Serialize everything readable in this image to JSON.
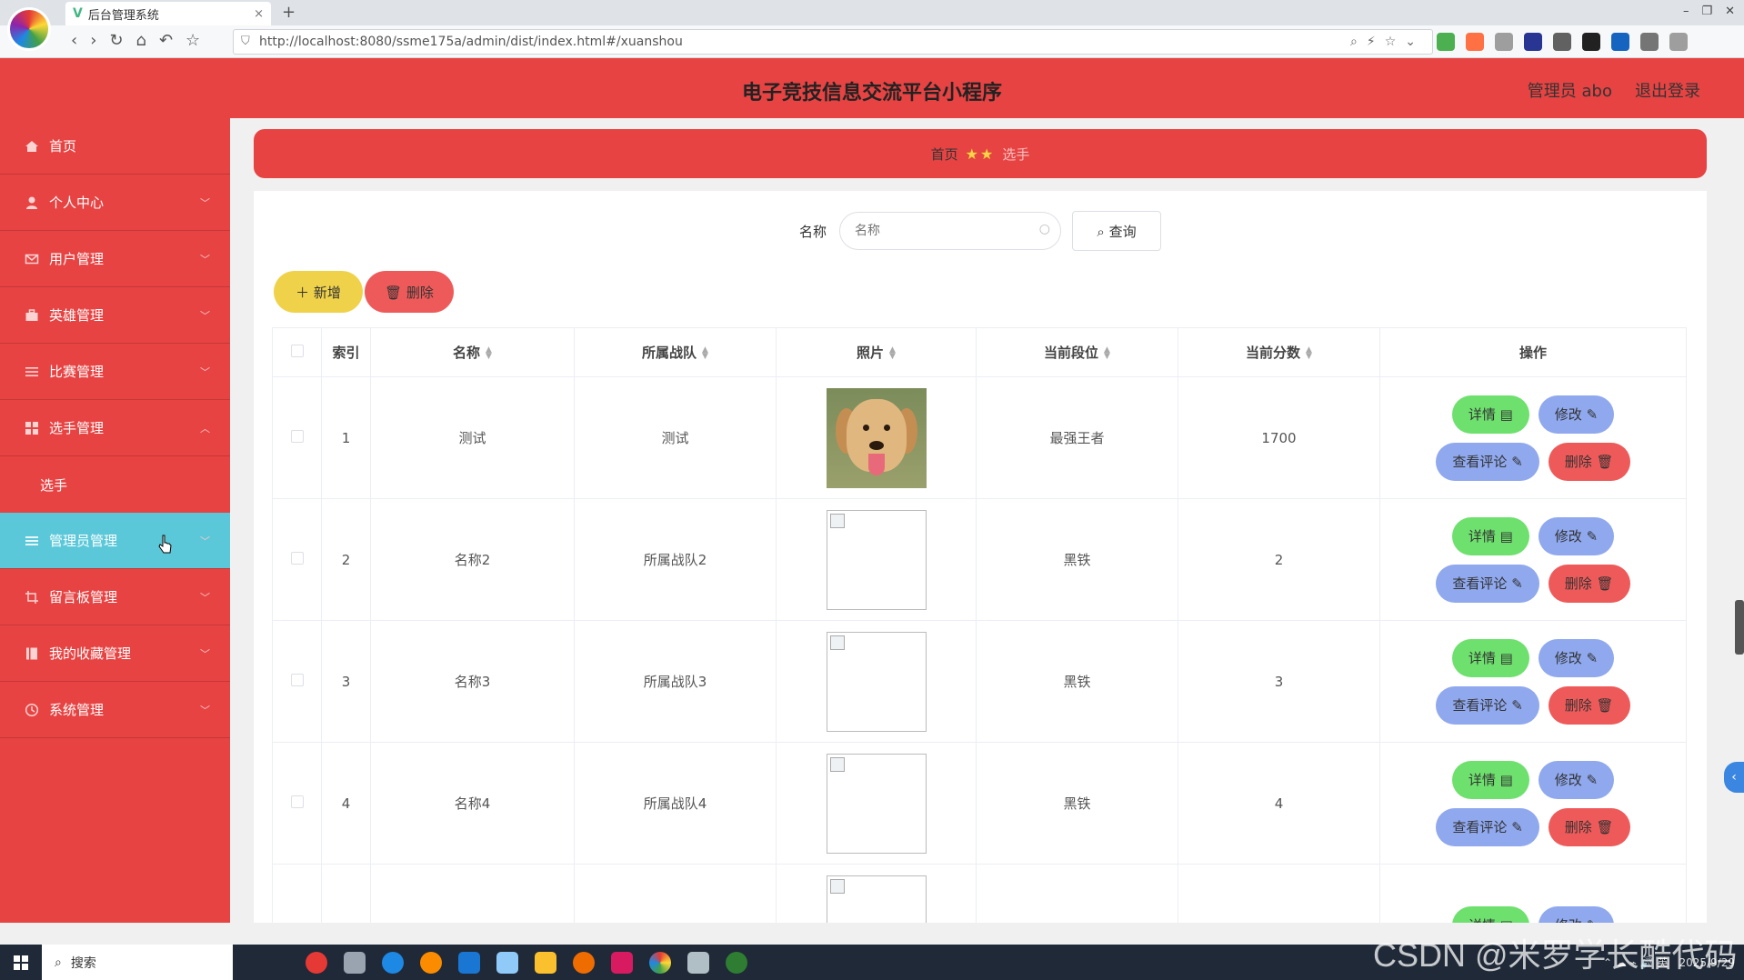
{
  "browser": {
    "tab_title": "后台管理系统",
    "tab_close": "×",
    "new_tab": "+",
    "url": "http://localhost:8080/ssme175a/admin/dist/index.html#/xuanshou"
  },
  "header": {
    "title": "电子竞技信息交流平台小程序",
    "user": "管理员 abo",
    "logout": "退出登录"
  },
  "sidebar": {
    "items": [
      {
        "label": "首页",
        "icon": "home-icon"
      },
      {
        "label": "个人中心",
        "icon": "user-icon"
      },
      {
        "label": "用户管理",
        "icon": "mail-icon"
      },
      {
        "label": "英雄管理",
        "icon": "briefcase-icon"
      },
      {
        "label": "比赛管理",
        "icon": "list-icon"
      },
      {
        "label": "选手管理",
        "icon": "grid-icon"
      },
      {
        "label": "管理员管理",
        "icon": "menu-icon"
      },
      {
        "label": "留言板管理",
        "icon": "crop-icon"
      },
      {
        "label": "我的收藏管理",
        "icon": "book-icon"
      },
      {
        "label": "系统管理",
        "icon": "clock-icon"
      }
    ],
    "sub_item": "选手"
  },
  "breadcrumb": {
    "home": "首页",
    "stars": "★★",
    "current": "选手"
  },
  "search": {
    "label": "名称",
    "placeholder": "名称",
    "button": "查询"
  },
  "actions": {
    "add": "＋ 新增",
    "delete": "🗑 删除"
  },
  "table": {
    "headers": [
      "索引",
      "名称",
      "所属战队",
      "照片",
      "当前段位",
      "当前分数",
      "操作"
    ],
    "rows": [
      {
        "index": "1",
        "name": "测试",
        "team": "测试",
        "rank": "最强王者",
        "score": "1700"
      },
      {
        "index": "2",
        "name": "名称2",
        "team": "所属战队2",
        "rank": "黑铁",
        "score": "2"
      },
      {
        "index": "3",
        "name": "名称3",
        "team": "所属战队3",
        "rank": "黑铁",
        "score": "3"
      },
      {
        "index": "4",
        "name": "名称4",
        "team": "所属战队4",
        "rank": "黑铁",
        "score": "4"
      },
      {
        "index": "",
        "name": "",
        "team": "",
        "rank": "",
        "score": ""
      }
    ],
    "ops": {
      "detail": "详情 ▤",
      "edit": "修改 ✎",
      "comment": "查看评论 ✎",
      "delete": "删除 🗑"
    }
  },
  "taskbar": {
    "search": "搜索",
    "date": "2025/9/29",
    "watermark": "CSDN @米罗学长酷代码"
  }
}
